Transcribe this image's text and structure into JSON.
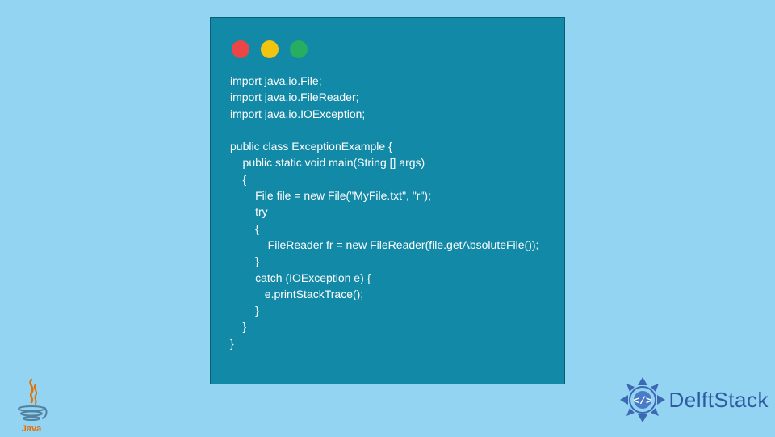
{
  "code": {
    "lines": [
      "import java.io.File;",
      "import java.io.FileReader;",
      "import java.io.IOException;",
      "",
      "public class ExceptionExample {",
      "    public static void main(String [] args)",
      "    {",
      "        File file = new File(\"MyFile.txt\", \"r\");",
      "        try",
      "        {",
      "            FileReader fr = new FileReader(file.getAbsoluteFile());",
      "        }",
      "        catch (IOException e) {",
      "           e.printStackTrace();",
      "        }",
      "    }",
      "}"
    ]
  },
  "logos": {
    "java_label": "Java",
    "delft_label": "DelftStack"
  },
  "colors": {
    "bg": "#93d4f2",
    "window": "#1289a7",
    "red": "#ec4545",
    "yellow": "#f1c40f",
    "green": "#27ae60",
    "delft": "#2d5aa0"
  }
}
